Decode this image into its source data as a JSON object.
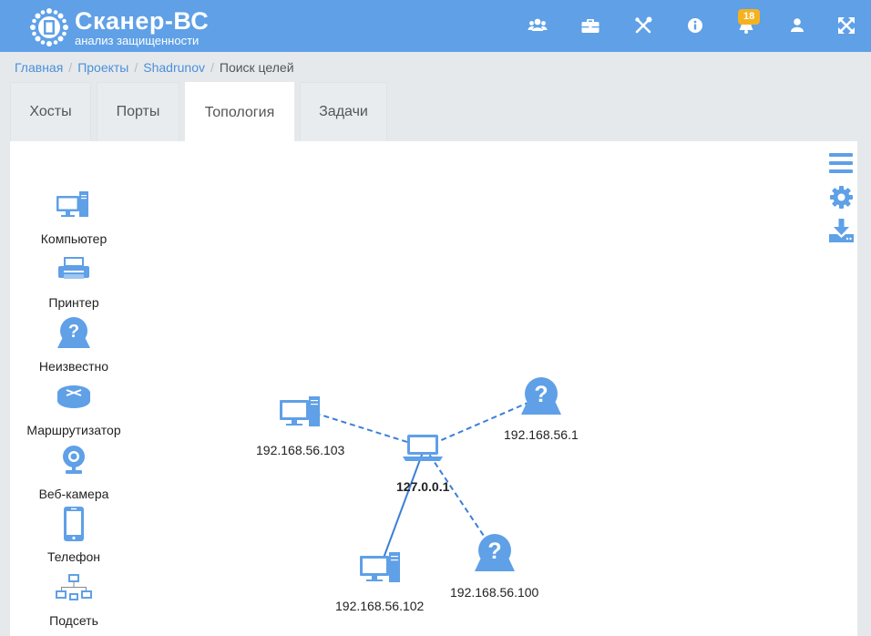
{
  "app": {
    "title": "Сканер-ВС",
    "subtitle": "анализ защищенности",
    "notification_count": "18",
    "colors": {
      "header": "#5fa0e7",
      "accent": "#4a90d9",
      "badge": "#f5b21f",
      "icon_blue": "#5fa0e7"
    }
  },
  "nav": {
    "icons": [
      "users-icon",
      "briefcase-icon",
      "tools-icon",
      "info-icon",
      "bell-icon",
      "user-icon",
      "fullscreen-icon"
    ]
  },
  "breadcrumb": [
    "Главная",
    "Проекты",
    "Shadrunov",
    "Поиск целей"
  ],
  "tabs": [
    "Хосты",
    "Порты",
    "Топология",
    "Задачи"
  ],
  "active_tab": "Топология",
  "legend": [
    "Компьютер",
    "Принтер",
    "Неизвестно",
    "Маршрутизатор",
    "Веб-камера",
    "Телефон",
    "Подсеть"
  ],
  "tools": [
    "menu-icon",
    "settings-icon",
    "download-icon"
  ],
  "graph": {
    "center": "127.0.0.1",
    "nodes": [
      "192.168.56.103",
      "192.168.56.1",
      "192.168.56.102",
      "192.168.56.100"
    ]
  }
}
